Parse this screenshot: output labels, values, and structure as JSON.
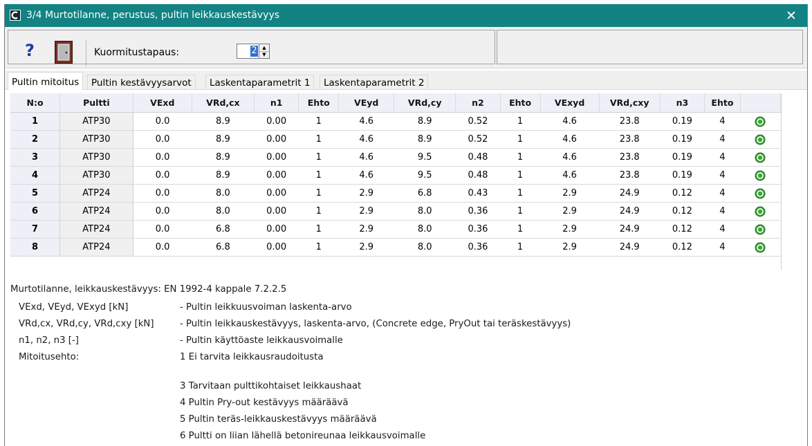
{
  "window": {
    "title": "3/4 Murtotilanne, perustus, pultin leikkauskestävyys",
    "close_glyph": "✕"
  },
  "toolbar": {
    "help_glyph": "?",
    "load_case_label": "Kuormitustapaus:",
    "load_case_value": "2",
    "spin_up_glyph": "▲",
    "spin_down_glyph": "▼"
  },
  "tabs": [
    {
      "label": "Pultin mitoitus",
      "active": true
    },
    {
      "label": "Pultin kestävyysarvot",
      "active": false
    },
    {
      "label": "Laskentaparametrit 1",
      "active": false
    },
    {
      "label": "Laskentaparametrit 2",
      "active": false
    }
  ],
  "table": {
    "headers": [
      "N:o",
      "Pultti",
      "VExd",
      "VRd,cx",
      "n1",
      "Ehto",
      "VEyd",
      "VRd,cy",
      "n2",
      "Ehto",
      "VExyd",
      "VRd,cxy",
      "n3",
      "Ehto",
      ""
    ],
    "rows": [
      [
        "1",
        "ATP30",
        "0.0",
        "8.9",
        "0.00",
        "1",
        "4.6",
        "8.9",
        "0.52",
        "1",
        "4.6",
        "23.8",
        "0.19",
        "4"
      ],
      [
        "2",
        "ATP30",
        "0.0",
        "8.9",
        "0.00",
        "1",
        "4.6",
        "8.9",
        "0.52",
        "1",
        "4.6",
        "23.8",
        "0.19",
        "4"
      ],
      [
        "3",
        "ATP30",
        "0.0",
        "8.9",
        "0.00",
        "1",
        "4.6",
        "9.5",
        "0.48",
        "1",
        "4.6",
        "23.8",
        "0.19",
        "4"
      ],
      [
        "4",
        "ATP30",
        "0.0",
        "8.9",
        "0.00",
        "1",
        "4.6",
        "9.5",
        "0.48",
        "1",
        "4.6",
        "23.8",
        "0.19",
        "4"
      ],
      [
        "5",
        "ATP24",
        "0.0",
        "8.0",
        "0.00",
        "1",
        "2.9",
        "6.8",
        "0.43",
        "1",
        "2.9",
        "24.9",
        "0.12",
        "4"
      ],
      [
        "6",
        "ATP24",
        "0.0",
        "8.0",
        "0.00",
        "1",
        "2.9",
        "8.0",
        "0.36",
        "1",
        "2.9",
        "24.9",
        "0.12",
        "4"
      ],
      [
        "7",
        "ATP24",
        "0.0",
        "6.8",
        "0.00",
        "1",
        "2.9",
        "8.0",
        "0.36",
        "1",
        "2.9",
        "24.9",
        "0.12",
        "4"
      ],
      [
        "8",
        "ATP24",
        "0.0",
        "6.8",
        "0.00",
        "1",
        "2.9",
        "8.0",
        "0.36",
        "1",
        "2.9",
        "24.9",
        "0.12",
        "4"
      ]
    ],
    "status_icon": "ok-check-icon"
  },
  "info": {
    "heading": "Murtotilanne, leikkauskestävyys: EN 1992-4 kappale 7.2.2.5",
    "definitions": [
      {
        "label": "VExd, VEyd, VExyd [kN]",
        "text": "- Pultin leikkuusvoiman laskenta-arvo"
      },
      {
        "label": "VRd,cx, VRd,cy, VRd,cxy [kN]",
        "text": "- Pultin leikkauskestävyys, laskenta-arvo, (Concrete edge, PryOut tai teräskestävyys)"
      },
      {
        "label": "n1, n2, n3 [-]",
        "text": "- Pultin käyttöaste leikkausvoimalle"
      },
      {
        "label": "Mitoitusehto:",
        "text": "1 Ei tarvita leikkausraudoitusta"
      }
    ],
    "conditions": [
      "3 Tarvitaan pulttikohtaiset leikkaushaat",
      "4 Pultin Pry-out kestävyys määräävä",
      "5 Pultin teräs-leikkauskestävyys määräävä",
      "6 Pultti on liian lähellä betonireunaa leikkausvoimalle"
    ]
  },
  "colors": {
    "titlebar": "#128283",
    "grid_header": "#eef0f8",
    "ok_icon": "#3aa535",
    "selection": "#2f6fd3"
  }
}
